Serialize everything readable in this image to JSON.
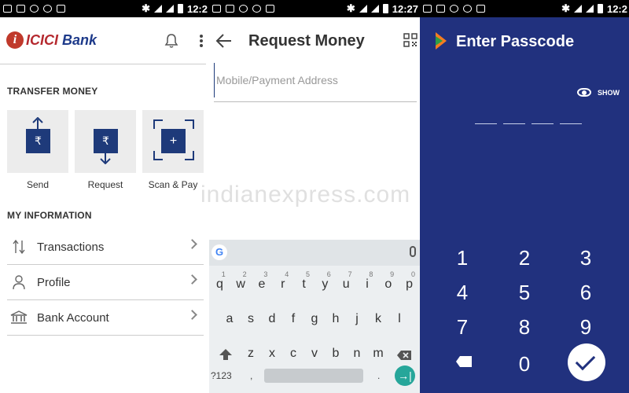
{
  "status_bar": {
    "time": "12:2"
  },
  "status_bar_p2": {
    "time": "12:27"
  },
  "status_bar_p3": {
    "time": "12:2"
  },
  "panel1": {
    "logo": {
      "brand_mark": "i",
      "brand_icici": "ICICI",
      "brand_bank": "Bank"
    },
    "transfer_title": "TRANSFER MONEY",
    "tiles": [
      {
        "label": "Send",
        "symbol": "₹"
      },
      {
        "label": "Request",
        "symbol": "₹"
      },
      {
        "label": "Scan & Pay",
        "symbol": "+"
      }
    ],
    "info_title": "MY INFORMATION",
    "items": [
      {
        "label": "Transactions",
        "icon": "transfer-arrows-icon"
      },
      {
        "label": "Profile",
        "icon": "person-icon"
      },
      {
        "label": "Bank Account",
        "icon": "bank-icon"
      }
    ]
  },
  "panel2": {
    "title": "Request Money",
    "input_placeholder": "Mobile/Payment Address",
    "watermark": "indianexpress.com",
    "keyboard": {
      "row1": [
        "q",
        "w",
        "e",
        "r",
        "t",
        "y",
        "u",
        "i",
        "o",
        "p"
      ],
      "row1_hints": [
        "1",
        "2",
        "3",
        "4",
        "5",
        "6",
        "7",
        "8",
        "9",
        "0"
      ],
      "row2": [
        "a",
        "s",
        "d",
        "f",
        "g",
        "h",
        "j",
        "k",
        "l"
      ],
      "row3": [
        "z",
        "x",
        "c",
        "v",
        "b",
        "n",
        "m"
      ],
      "symbols_key": "?123",
      "comma_key": ",",
      "period_key": ".",
      "google_letter": "G",
      "enter_symbol": "→|"
    }
  },
  "panel3": {
    "title": "Enter Passcode",
    "show_label": "SHOW",
    "keys": [
      "1",
      "2",
      "3",
      "4",
      "5",
      "6",
      "7",
      "8",
      "9",
      "0"
    ]
  },
  "colors": {
    "brand_blue": "#1e3a7a",
    "passcode_bg": "#21317e",
    "icici_red": "#b5292f",
    "enter_teal": "#26a69a"
  }
}
